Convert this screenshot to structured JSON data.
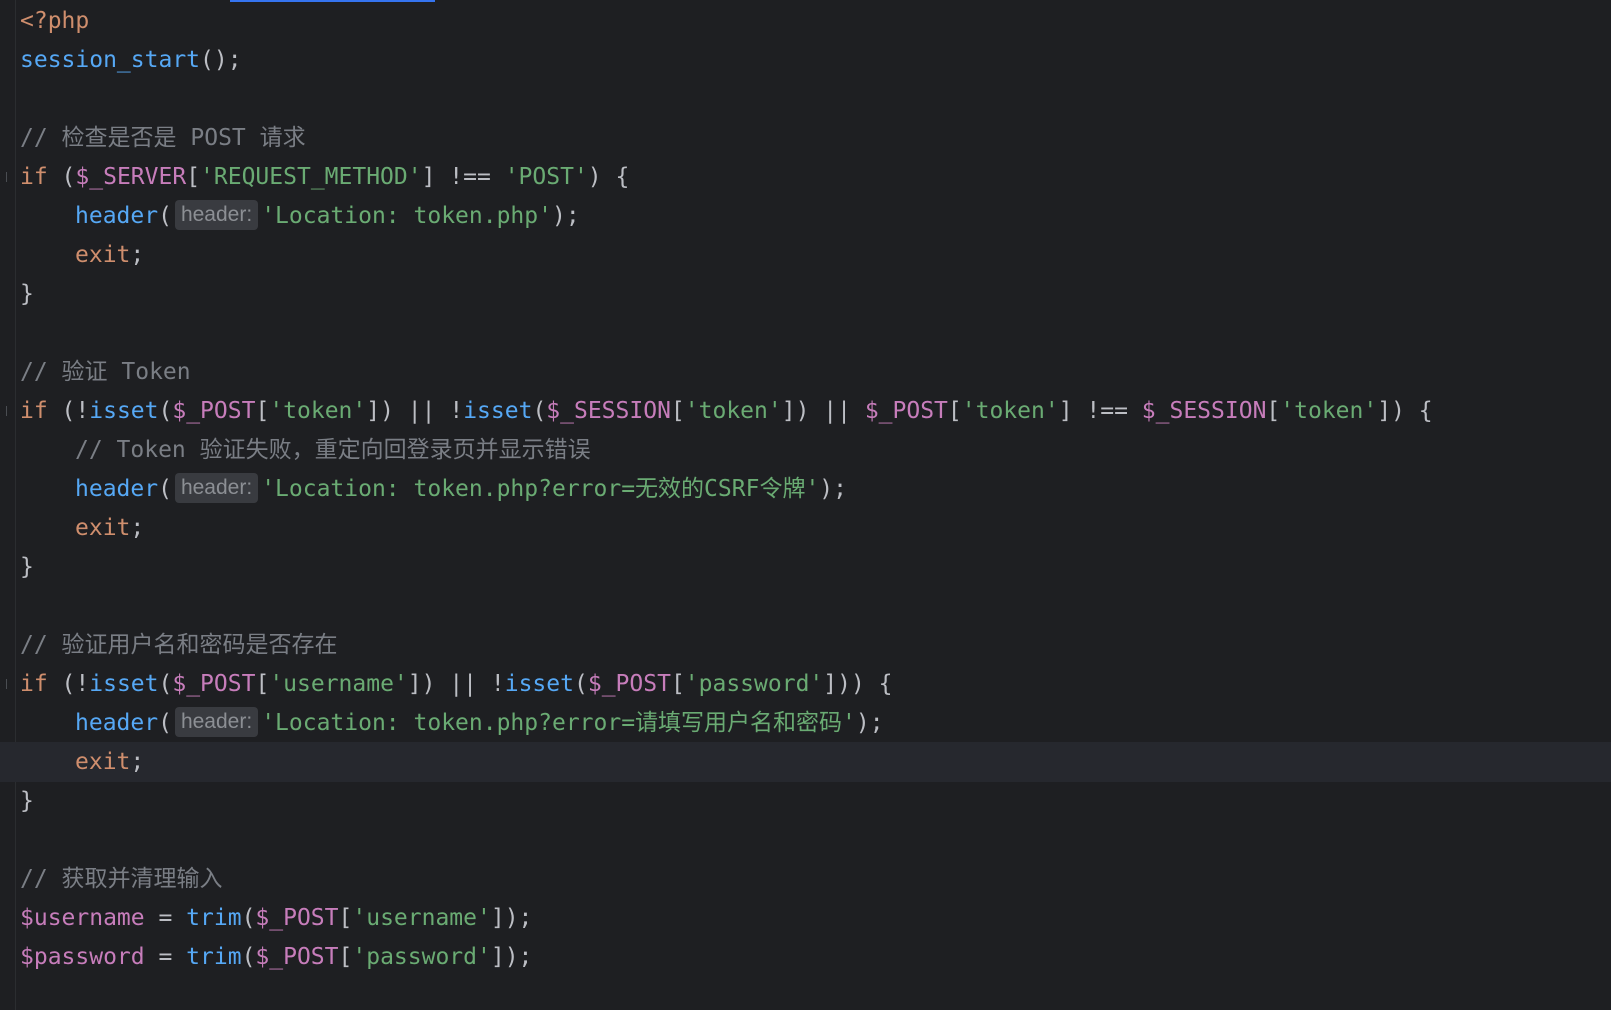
{
  "editor": {
    "language": "php",
    "current_line": 19,
    "colors": {
      "background": "#1e1f22",
      "keyword": "#cf8e6d",
      "function": "#56a8f5",
      "variable": "#c77dbb",
      "string": "#6aab73",
      "comment": "#7a7e85",
      "text": "#bcbec4",
      "inlay_hint_bg": "#393b40"
    }
  },
  "lines": [
    {
      "indent": 0,
      "tokens": [
        {
          "t": "kw",
          "v": "<?php"
        }
      ]
    },
    {
      "indent": 0,
      "tokens": [
        {
          "t": "fn",
          "v": "session_start"
        },
        {
          "t": "op",
          "v": "();"
        }
      ]
    },
    {
      "indent": 0,
      "tokens": []
    },
    {
      "indent": 0,
      "tokens": [
        {
          "t": "cm",
          "v": "// 检查是否是 POST 请求"
        }
      ]
    },
    {
      "indent": 0,
      "fold": true,
      "tokens": [
        {
          "t": "kw",
          "v": "if"
        },
        {
          "t": "op",
          "v": " ("
        },
        {
          "t": "var",
          "v": "$_SERVER"
        },
        {
          "t": "op",
          "v": "["
        },
        {
          "t": "str",
          "v": "'REQUEST_METHOD'"
        },
        {
          "t": "op",
          "v": "] !== "
        },
        {
          "t": "str",
          "v": "'POST'"
        },
        {
          "t": "op",
          "v": ") {"
        }
      ]
    },
    {
      "indent": 1,
      "tokens": [
        {
          "t": "fn",
          "v": "header"
        },
        {
          "t": "op",
          "v": "("
        },
        {
          "t": "hint",
          "v": "header:"
        },
        {
          "t": "str",
          "v": "'Location: token.php'"
        },
        {
          "t": "op",
          "v": ");"
        }
      ]
    },
    {
      "indent": 1,
      "tokens": [
        {
          "t": "kw",
          "v": "exit"
        },
        {
          "t": "op",
          "v": ";"
        }
      ]
    },
    {
      "indent": 0,
      "tokens": [
        {
          "t": "op",
          "v": "}"
        }
      ]
    },
    {
      "indent": 0,
      "tokens": []
    },
    {
      "indent": 0,
      "tokens": [
        {
          "t": "cm",
          "v": "// 验证 Token"
        }
      ]
    },
    {
      "indent": 0,
      "fold": true,
      "tokens": [
        {
          "t": "kw",
          "v": "if"
        },
        {
          "t": "op",
          "v": " (!"
        },
        {
          "t": "fn",
          "v": "isset"
        },
        {
          "t": "op",
          "v": "("
        },
        {
          "t": "var",
          "v": "$_POST"
        },
        {
          "t": "op",
          "v": "["
        },
        {
          "t": "str",
          "v": "'token'"
        },
        {
          "t": "op",
          "v": "]) || !"
        },
        {
          "t": "fn",
          "v": "isset"
        },
        {
          "t": "op",
          "v": "("
        },
        {
          "t": "var",
          "v": "$_SESSION"
        },
        {
          "t": "op",
          "v": "["
        },
        {
          "t": "str",
          "v": "'token'"
        },
        {
          "t": "op",
          "v": "]) || "
        },
        {
          "t": "var",
          "v": "$_POST"
        },
        {
          "t": "op",
          "v": "["
        },
        {
          "t": "str",
          "v": "'token'"
        },
        {
          "t": "op",
          "v": "] !== "
        },
        {
          "t": "var",
          "v": "$_SESSION"
        },
        {
          "t": "op",
          "v": "["
        },
        {
          "t": "str",
          "v": "'token'"
        },
        {
          "t": "op",
          "v": "]) {"
        }
      ]
    },
    {
      "indent": 1,
      "tokens": [
        {
          "t": "cm",
          "v": "// Token 验证失败，重定向回登录页并显示错误"
        }
      ]
    },
    {
      "indent": 1,
      "tokens": [
        {
          "t": "fn",
          "v": "header"
        },
        {
          "t": "op",
          "v": "("
        },
        {
          "t": "hint",
          "v": "header:"
        },
        {
          "t": "str",
          "v": "'Location: token.php?error=无效的CSRF令牌'"
        },
        {
          "t": "op",
          "v": ");"
        }
      ]
    },
    {
      "indent": 1,
      "tokens": [
        {
          "t": "kw",
          "v": "exit"
        },
        {
          "t": "op",
          "v": ";"
        }
      ]
    },
    {
      "indent": 0,
      "tokens": [
        {
          "t": "op",
          "v": "}"
        }
      ]
    },
    {
      "indent": 0,
      "tokens": []
    },
    {
      "indent": 0,
      "tokens": [
        {
          "t": "cm",
          "v": "// 验证用户名和密码是否存在"
        }
      ]
    },
    {
      "indent": 0,
      "fold": true,
      "tokens": [
        {
          "t": "kw",
          "v": "if"
        },
        {
          "t": "op",
          "v": " (!"
        },
        {
          "t": "fn",
          "v": "isset"
        },
        {
          "t": "op",
          "v": "("
        },
        {
          "t": "var",
          "v": "$_POST"
        },
        {
          "t": "op",
          "v": "["
        },
        {
          "t": "str",
          "v": "'username'"
        },
        {
          "t": "op",
          "v": "]) || !"
        },
        {
          "t": "fn",
          "v": "isset"
        },
        {
          "t": "op",
          "v": "("
        },
        {
          "t": "var",
          "v": "$_POST"
        },
        {
          "t": "op",
          "v": "["
        },
        {
          "t": "str",
          "v": "'password'"
        },
        {
          "t": "op",
          "v": "])) {"
        }
      ]
    },
    {
      "indent": 1,
      "tokens": [
        {
          "t": "fn",
          "v": "header"
        },
        {
          "t": "op",
          "v": "("
        },
        {
          "t": "hint",
          "v": "header:"
        },
        {
          "t": "str",
          "v": "'Location: token.php?error=请填写用户名和密码'"
        },
        {
          "t": "op",
          "v": ");"
        }
      ]
    },
    {
      "indent": 1,
      "tokens": [
        {
          "t": "kw",
          "v": "exit"
        },
        {
          "t": "op",
          "v": ";"
        }
      ]
    },
    {
      "indent": 0,
      "tokens": [
        {
          "t": "op",
          "v": "}"
        }
      ]
    },
    {
      "indent": 0,
      "tokens": []
    },
    {
      "indent": 0,
      "tokens": [
        {
          "t": "cm",
          "v": "// 获取并清理输入"
        }
      ]
    },
    {
      "indent": 0,
      "tokens": [
        {
          "t": "var",
          "v": "$username"
        },
        {
          "t": "op",
          "v": " = "
        },
        {
          "t": "fn",
          "v": "trim"
        },
        {
          "t": "op",
          "v": "("
        },
        {
          "t": "var",
          "v": "$_POST"
        },
        {
          "t": "op",
          "v": "["
        },
        {
          "t": "str",
          "v": "'username'"
        },
        {
          "t": "op",
          "v": "]);"
        }
      ]
    },
    {
      "indent": 0,
      "tokens": [
        {
          "t": "var",
          "v": "$password"
        },
        {
          "t": "op",
          "v": " = "
        },
        {
          "t": "fn",
          "v": "trim"
        },
        {
          "t": "op",
          "v": "("
        },
        {
          "t": "var",
          "v": "$_POST"
        },
        {
          "t": "op",
          "v": "["
        },
        {
          "t": "str",
          "v": "'password'"
        },
        {
          "t": "op",
          "v": "]);"
        }
      ]
    }
  ]
}
